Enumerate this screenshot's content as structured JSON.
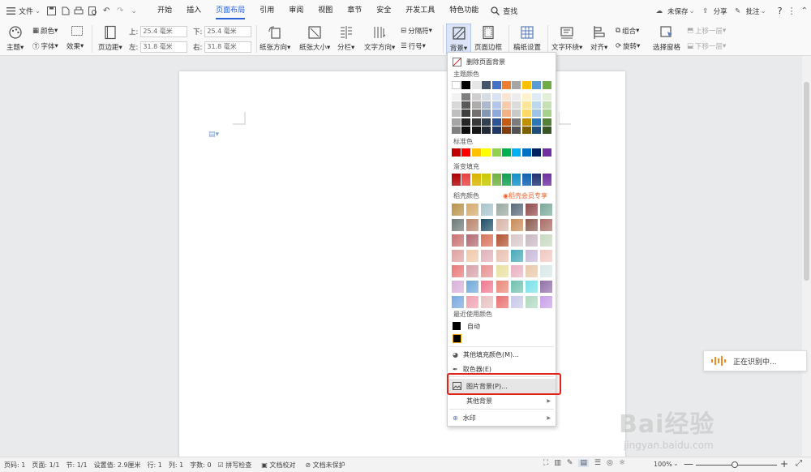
{
  "topbar": {
    "menu_label": "文件",
    "tabs": [
      "开始",
      "插入",
      "页面布局",
      "引用",
      "审阅",
      "视图",
      "章节",
      "安全",
      "开发工具",
      "特色功能"
    ],
    "active_tab": "页面布局",
    "search_label": "查找",
    "unsaved_label": "未保存",
    "share_label": "分享",
    "comment_label": "批注",
    "help_label": "?"
  },
  "ribbon": {
    "theme": "主题",
    "color": "颜色",
    "font": "字体",
    "effect": "效果",
    "margin": "页边距",
    "top_label": "上:",
    "top_value": "25.4 毫米",
    "bottom_label": "下:",
    "bottom_value": "25.4 毫米",
    "left_label": "左:",
    "left_value": "31.8 毫米",
    "right_label": "右:",
    "right_value": "31.8 毫米",
    "orientation": "纸张方向",
    "size": "纸张大小",
    "columns": "分栏",
    "text_direction": "文字方向",
    "separator": "分隔符",
    "line_number": "行号",
    "background": "背景",
    "page_border": "页面边框",
    "draft_setting": "稿纸设置",
    "text_wrap": "文字环绕",
    "align": "对齐",
    "rotate": "旋转",
    "group": "组合",
    "selection_pane": "选择窗格",
    "bring_forward": "上移一层",
    "send_backward": "下移一层"
  },
  "dropdown": {
    "delete_bg": "删除页面背景",
    "theme_colors": "主题颜色",
    "standard_colors": "标准色",
    "gradient_fill": "渐变填充",
    "paper_colors": "稻壳颜色",
    "paper_vip": "稻壳会员专享",
    "recent_colors": "最近使用颜色",
    "auto": "自动",
    "more_fill": "其他填充颜色(M)...",
    "eyedropper": "取色器(E)",
    "picture_bg": "图片背景(P)...",
    "other_bg": "其他背景",
    "watermark": "水印",
    "theme_top": [
      "#ffffff",
      "#000000",
      "#e7e6e6",
      "#44546a",
      "#4472c4",
      "#ed7d31",
      "#a5a5a5",
      "#ffc000",
      "#5b9bd5",
      "#70ad47"
    ],
    "theme_shades": [
      [
        "#f2f2f2",
        "#7f7f7f",
        "#d0cece",
        "#d6dce4",
        "#d9e2f3",
        "#fbe5d5",
        "#ededed",
        "#fff2cc",
        "#deebf6",
        "#e2efd9"
      ],
      [
        "#d8d8d8",
        "#595959",
        "#aeabab",
        "#adb9ca",
        "#b4c6e7",
        "#f7cbac",
        "#dbdbdb",
        "#fee599",
        "#bdd7ee",
        "#c5e0b3"
      ],
      [
        "#bfbfbf",
        "#3f3f3f",
        "#757070",
        "#8496b0",
        "#8eaadb",
        "#f4b183",
        "#c9c9c9",
        "#ffd965",
        "#9dc3e6",
        "#a8d08d"
      ],
      [
        "#a5a5a5",
        "#262626",
        "#3a3838",
        "#323f4f",
        "#2f5496",
        "#c55a11",
        "#7b7b7b",
        "#bf9000",
        "#2e75b5",
        "#538135"
      ],
      [
        "#7f7f7f",
        "#0c0c0c",
        "#171616",
        "#222a35",
        "#1f3864",
        "#833c0b",
        "#525252",
        "#7f6000",
        "#1e4e79",
        "#375623"
      ]
    ],
    "standard": [
      "#c00000",
      "#ff0000",
      "#ffc000",
      "#ffff00",
      "#92d050",
      "#00b050",
      "#00b0f0",
      "#0070c0",
      "#002060",
      "#7030a0"
    ],
    "gradients": [
      "#b00000",
      "#e84040",
      "#d8b400",
      "#c8c800",
      "#70b040",
      "#10a050",
      "#1090c8",
      "#1060b0",
      "#203070",
      "#7030a0"
    ],
    "paper_rows": [
      [
        "#b89246",
        "#d4a96a",
        "#a8c4cc",
        "#9aa8a0",
        "#5a6878",
        "#8e4a4a",
        "#7aa898"
      ],
      [
        "#6e7a78",
        "#b8846a",
        "#1e4e6a",
        "#d6b4a8",
        "#c88a58",
        "#8a5a4e",
        "#a86c64"
      ],
      [
        "#c87070",
        "#b06870",
        "#d87058",
        "#b05030",
        "#d8c8c8",
        "#c8b8c0",
        "#c8d8c0"
      ],
      [
        "#e0a0a0",
        "#f0c8a8",
        "#e0b0b8",
        "#e8c0b0",
        "#48a8b8",
        "#c8b8d8",
        "#f0c8c0"
      ],
      [
        "#e87878",
        "#d8a0a8",
        "#e89090",
        "#e8e0a0",
        "#e8b0c0",
        "#e8c8a8",
        "#d8e8e8"
      ],
      [
        "#d8b0d8",
        "#70a8d8",
        "#f07890",
        "#e88878",
        "#70c0b0",
        "#78e0e8",
        "#9070a8"
      ],
      [
        "#78a8e0",
        "#f0a0b0",
        "#e8c0c0",
        "#e87070",
        "#c8c8e8",
        "#b0d8c0",
        "#c8a0e8"
      ]
    ]
  },
  "status": {
    "page_code": "页码: 1",
    "pages": "页面: 1/1",
    "section": "节: 1/1",
    "setting": "设置值: 2.9厘米",
    "row": "行: 1",
    "col": "列: 1",
    "words": "字数: 0",
    "spell": "拼写检查",
    "proof": "文档校对",
    "protect": "文档未保护",
    "zoom": "100%"
  },
  "voice": {
    "label": "正在识别中..."
  },
  "watermark_brand": "Bai经验",
  "watermark_url": "jingyan.baidu.com"
}
